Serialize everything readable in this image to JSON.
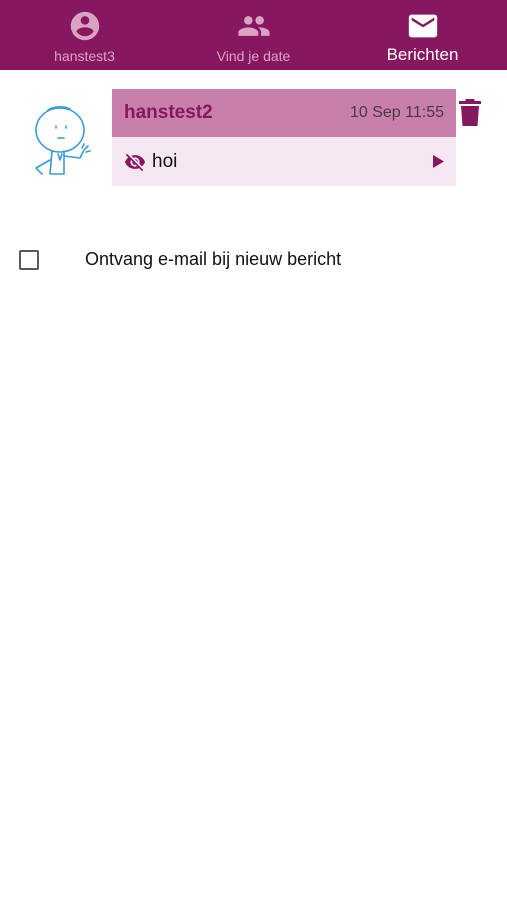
{
  "nav": {
    "tabs": [
      {
        "label": "hanstest3",
        "icon": "account-circle-icon",
        "active": false
      },
      {
        "label": "Vind je date",
        "icon": "people-icon",
        "active": false
      },
      {
        "label": "Berichten",
        "icon": "mail-icon",
        "active": true
      }
    ]
  },
  "messages": [
    {
      "sender": "hanstest2",
      "time": "10 Sep 11:55",
      "preview": "hoi",
      "status_icon": "eye-off-icon",
      "open_icon": "play-arrow-icon",
      "delete_icon": "trash-icon",
      "avatar_icon": "cartoon-avatar-icon"
    }
  ],
  "settings": {
    "email_notify_label": "Ontvang e-mail bij nieuw bericht",
    "email_notify_checked": false
  },
  "colors": {
    "brand": "#87185f",
    "header_bg": "#c87faa",
    "body_bg": "#f5e8f1",
    "tab_inactive": "#d9a3c4"
  }
}
